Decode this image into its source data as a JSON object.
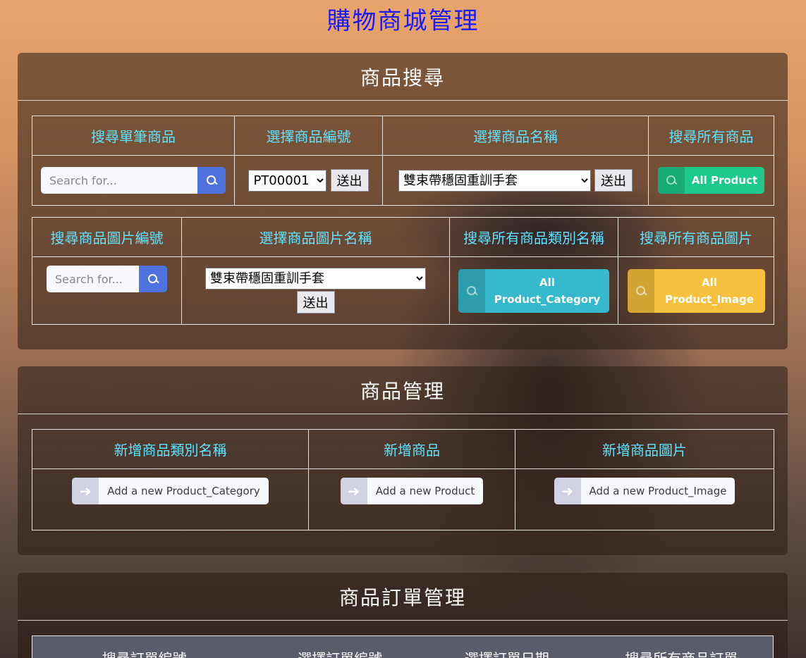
{
  "site_title": "購物商城管理",
  "search_panel": {
    "title": "商品搜尋",
    "row1_headers": [
      "搜尋單筆商品",
      "選擇商品編號",
      "選擇商品名稱",
      "搜尋所有商品"
    ],
    "single_search_placeholder": "Search for...",
    "product_id_selected": "PT00001",
    "product_name_selected": "雙束帶穩固重訓手套",
    "submit_label": "送出",
    "all_product_label": "All Product",
    "row2_headers": [
      "搜尋商品圖片編號",
      "選擇商品圖片名稱",
      "搜尋所有商品類別名稱",
      "搜尋所有商品圖片"
    ],
    "image_search_placeholder": "Search for...",
    "image_name_selected": "雙束帶穩固重訓手套",
    "all_category_line1": "All",
    "all_category_line2": "Product_Category",
    "all_image_line1": "All",
    "all_image_line2": "Product_Image"
  },
  "manage_panel": {
    "title": "商品管理",
    "headers": [
      "新增商品類別名稱",
      "新增商品",
      "新增商品圖片"
    ],
    "add_category_label": "Add a new Product_Category",
    "add_product_label": "Add a new Product",
    "add_image_label": "Add a new Product_Image"
  },
  "order_panel": {
    "title": "商品訂單管理",
    "headers": [
      "搜尋訂單編號",
      "選擇訂單編號",
      "選擇訂單日期",
      "搜尋所有商品訂單"
    ]
  },
  "colors": {
    "title_blue": "#1a1aff",
    "header_cyan": "#5fe2ff",
    "primary": "#4e73df",
    "success": "#1cc88a",
    "info": "#36b9cc",
    "warning": "#f6c23e"
  },
  "icons": [
    "search-icon",
    "arrow-right-icon"
  ]
}
